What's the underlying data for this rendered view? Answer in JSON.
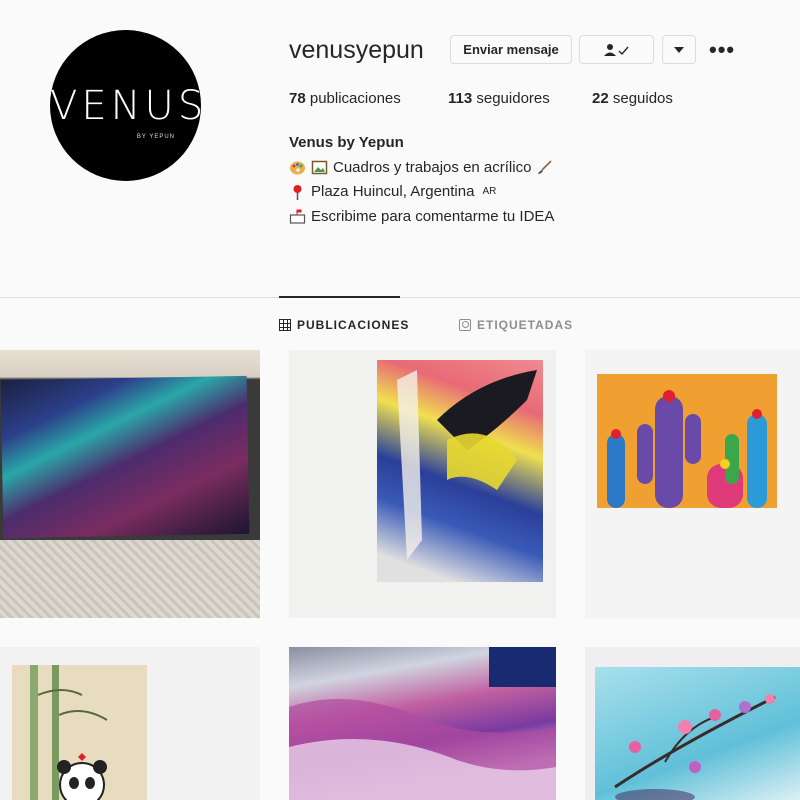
{
  "profile": {
    "avatar_word": "VENUS",
    "avatar_sub": "BY YEPUN",
    "username": "venusyepun",
    "message_button": "Enviar mensaje",
    "following_icon": "person-check-icon",
    "dropdown_icon": "caret-down-icon",
    "more_icon": "more-dots-icon",
    "more_glyph": "•••"
  },
  "stats": {
    "posts_count": "78",
    "posts_label": " publicaciones",
    "followers_count": "113",
    "followers_label": " seguidores",
    "following_count": "22",
    "following_label": " seguidos"
  },
  "bio": {
    "name": "Venus by Yepun",
    "line1": "Cuadros y trabajos en acrílico",
    "line2": "Plaza Huincul, Argentina",
    "line2_flag": "AR",
    "line3": "Escribime para comentarme tu IDEA"
  },
  "tabs": {
    "posts": "PUBLICACIONES",
    "tagged": "ETIQUETADAS"
  },
  "posts": [
    {
      "name": "post-galaxy-painting"
    },
    {
      "name": "post-abstract-painting"
    },
    {
      "name": "post-cactus-painting"
    },
    {
      "name": "post-bamboo-panda-painting"
    },
    {
      "name": "post-purple-abstract-painting"
    },
    {
      "name": "post-cherry-blossom-painting"
    }
  ],
  "colors": {
    "text": "#262626",
    "muted": "#8e8e8e",
    "border": "#dbdbdb",
    "background": "#fafafa"
  }
}
